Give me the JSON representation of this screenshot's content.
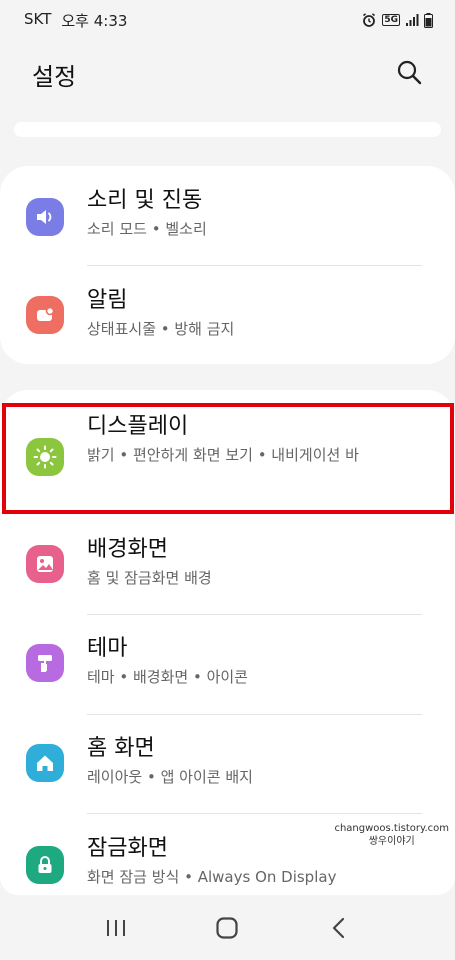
{
  "status_bar": {
    "carrier": "SKT",
    "time": "오후 4:33",
    "network": "5G"
  },
  "header": {
    "title": "설정",
    "search_icon": "search-icon"
  },
  "groups": [
    {
      "items": [
        {
          "title": "소리 및 진동",
          "subtitle": "소리 모드 • 벨소리",
          "icon": "volume-icon",
          "color": "#7b7de6"
        },
        {
          "title": "알림",
          "subtitle": "상태표시줄 • 방해 금지",
          "icon": "notification-icon",
          "color": "#ee6e61"
        }
      ]
    },
    {
      "items": [
        {
          "title": "디스플레이",
          "subtitle": "밝기 • 편안하게 화면 보기 • 내비게이션 바",
          "icon": "sun-icon",
          "color": "#8cc63f",
          "highlighted": true
        },
        {
          "title": "배경화면",
          "subtitle": "홈 및 잠금화면 배경",
          "icon": "wallpaper-icon",
          "color": "#e8618c"
        },
        {
          "title": "테마",
          "subtitle": "테마 • 배경화면 • 아이콘",
          "icon": "paint-roller-icon",
          "color": "#b86be0"
        },
        {
          "title": "홈 화면",
          "subtitle": "레이아웃 • 앱 아이콘 배지",
          "icon": "home-icon",
          "color": "#2eaed8"
        },
        {
          "title": "잠금화면",
          "subtitle": "화면 잠금 방식 • Always On Display",
          "icon": "lock-icon",
          "color": "#1ea980"
        }
      ]
    }
  ],
  "watermark": {
    "line1": "changwoos.tistory.com",
    "line2": "쌍우이야기"
  },
  "nav_bar": {
    "recents_icon": "recents-icon",
    "home_icon": "home-button-icon",
    "back_icon": "back-icon"
  }
}
